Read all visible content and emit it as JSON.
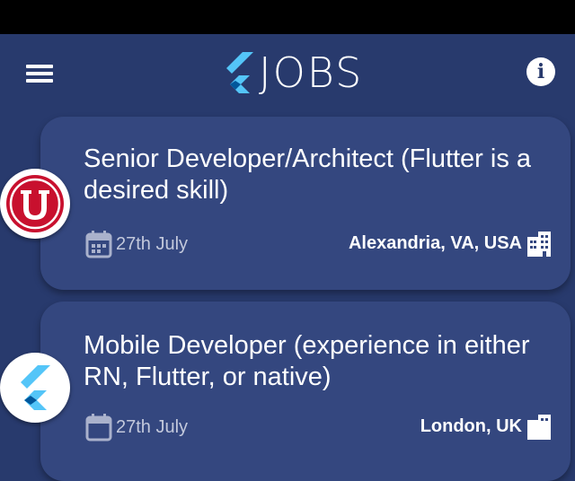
{
  "app": {
    "title": "JOBS",
    "logo_icon": "flutter-logo-icon",
    "menu_icon": "hamburger-menu-icon",
    "info_icon": "info-icon",
    "colors": {
      "background": "#283a6d",
      "card": "#34477f",
      "flutter_light": "#54c5f8",
      "flutter_dark": "#01579b",
      "logo_red": "#c8102e"
    }
  },
  "jobs": [
    {
      "title": "Senior Developer/Architect (Flutter is a desired skill)",
      "date": "27th July",
      "location": "Alexandria, VA, USA",
      "company_logo": "company-u-logo"
    },
    {
      "title": "Mobile Developer (experience in either RN, Flutter, or native)",
      "date": "27th July",
      "location": "London, UK",
      "company_logo": "flutter-logo"
    }
  ]
}
